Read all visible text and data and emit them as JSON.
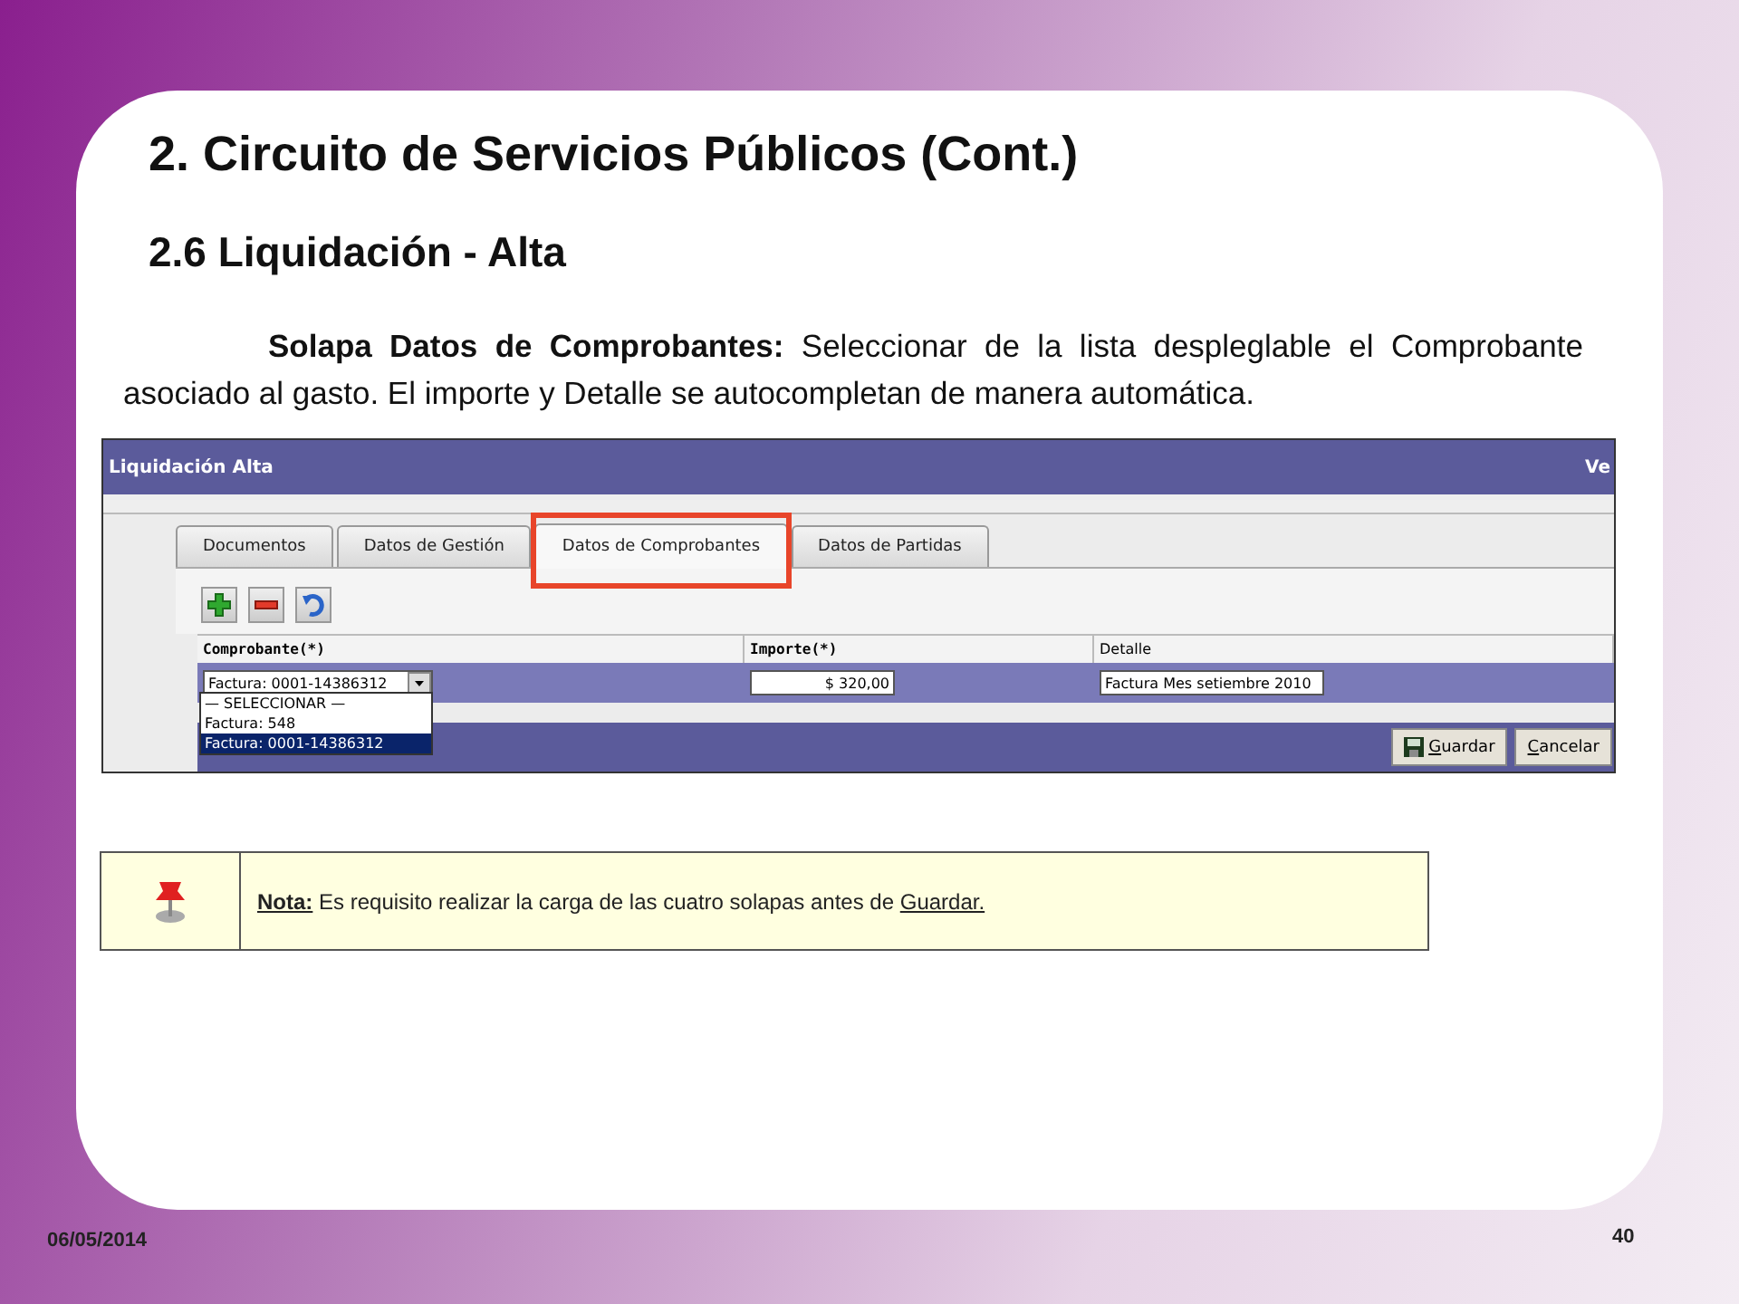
{
  "slide": {
    "title": "2. Circuito de Servicios Públicos (Cont.)",
    "subtitle": "2.6 Liquidación - Alta",
    "paragraph": "**Solapa Datos de Comprobantes:** Seleccionar de la lista despleglable el Comprobante asociado al gasto. El importe y Detalle se autocompletan de manera automática.",
    "date": "06/05/2014",
    "page_number": "40"
  },
  "window": {
    "title": "Liquidación Alta",
    "title_right": "Ve",
    "tabs": [
      {
        "label": "Documentos",
        "selected": false
      },
      {
        "label": "Datos de Gestión",
        "selected": false
      },
      {
        "label": "Datos de Comprobantes",
        "selected": true
      },
      {
        "label": "Datos de Partidas",
        "selected": false
      }
    ],
    "table": {
      "columns": [
        "Comprobante(*)",
        "Importe(*)",
        "Detalle"
      ],
      "row": {
        "comprobante": "Factura: 0001-14386312",
        "importe": "$ 320,00",
        "detalle": "Factura Mes setiembre 2010"
      }
    },
    "dropdown": [
      {
        "label": "— SELECCIONAR —",
        "selected": false
      },
      {
        "label": "Factura: 548",
        "selected": false
      },
      {
        "label": "Factura: 0001-14386312",
        "selected": true
      }
    ],
    "buttons": [
      "Guardar",
      "Cancelar"
    ]
  },
  "note": {
    "label": "Nota:",
    "text": "Es requisito realizar la carga de las cuatro solapas antes de",
    "link": "Guardar."
  }
}
